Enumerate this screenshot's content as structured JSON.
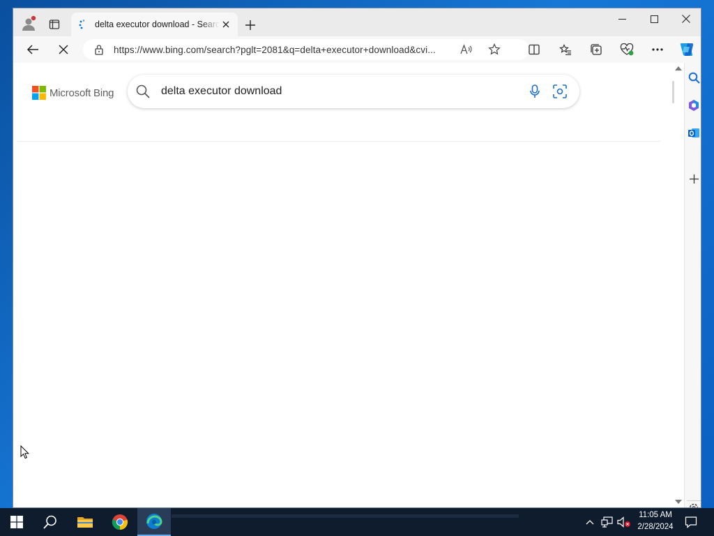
{
  "browser": {
    "tab": {
      "title": "delta executor download - Search",
      "close_icon": "close-icon"
    },
    "address_bar": {
      "url": "https://www.bing.com/search?pglt=2081&q=delta+executor+download&cvi..."
    },
    "colors": {
      "accent": "#0a6ec8",
      "profile_badge": "#d13438"
    }
  },
  "page": {
    "logo_text": "Microsoft Bing",
    "search_query": "delta executor download",
    "logo_colors": [
      "#f25022",
      "#7fba00",
      "#00a4ef",
      "#ffb900"
    ]
  },
  "taskbar": {
    "time": "11:05 AM",
    "date": "2/28/2024"
  }
}
